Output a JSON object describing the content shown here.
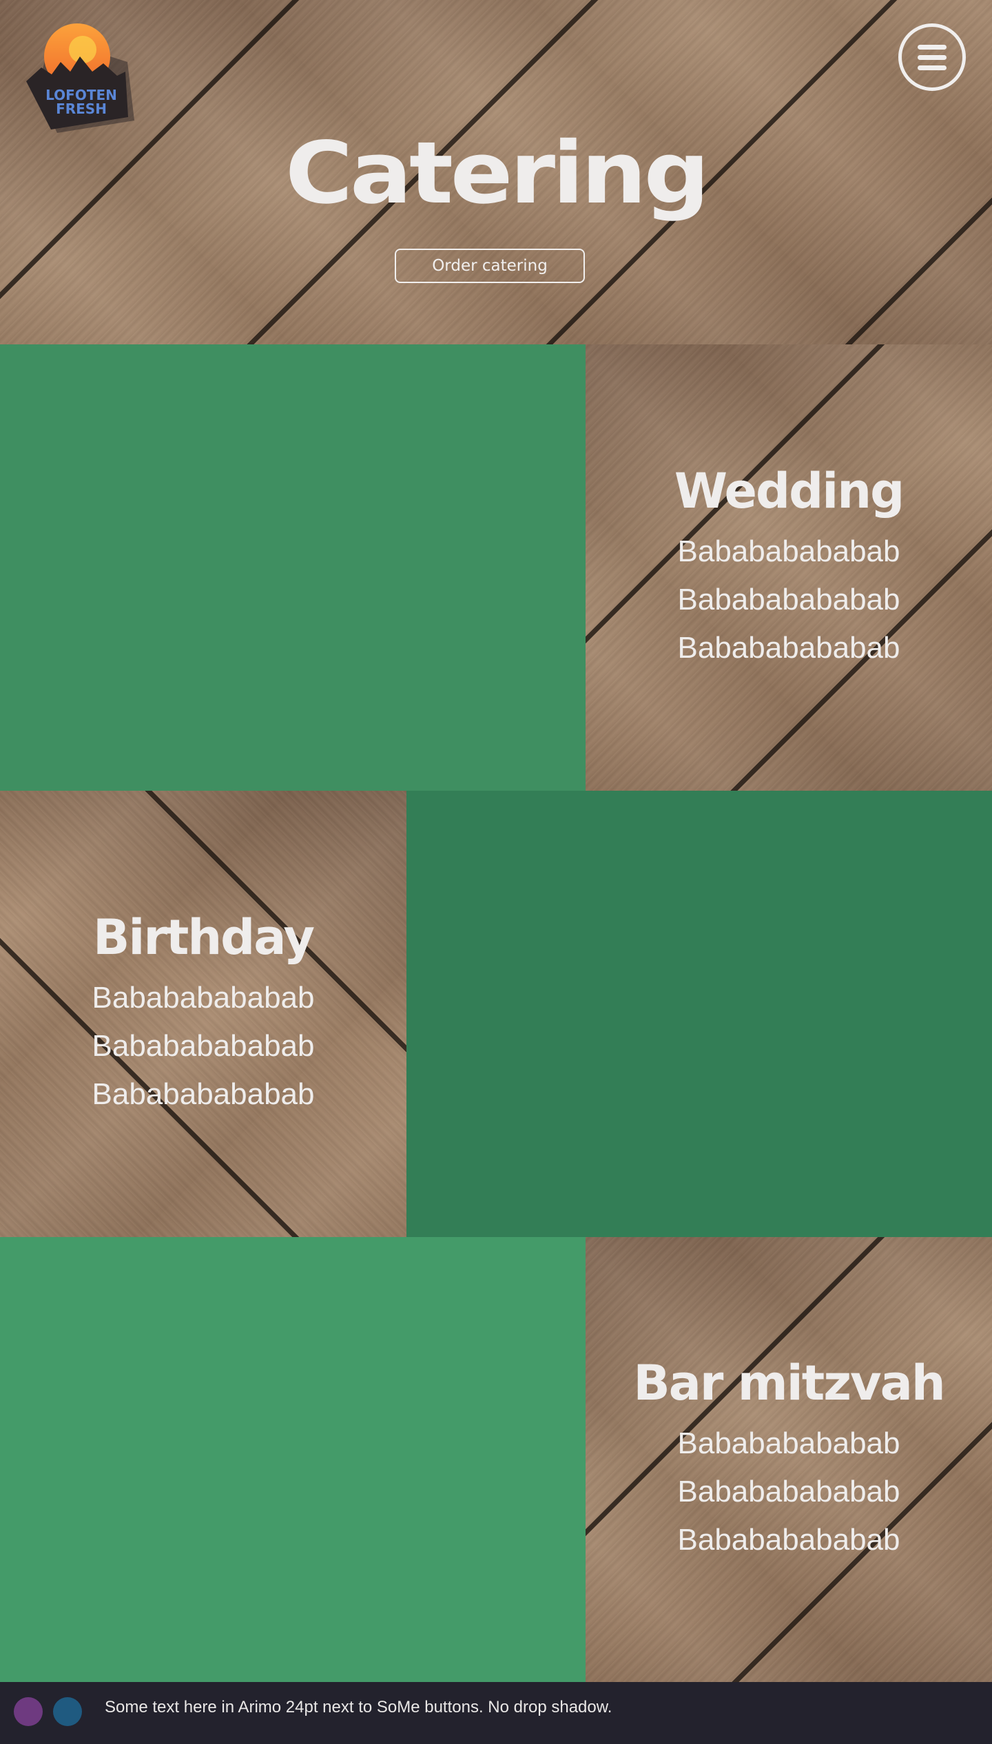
{
  "brand": {
    "line1": "LOFOTEN",
    "line2": "FRESH"
  },
  "hero": {
    "title": "Catering",
    "order_button": "Order catering"
  },
  "events": [
    {
      "title": "Wedding",
      "lines": [
        "Babababababab",
        "Babababababab",
        "Babababababab"
      ]
    },
    {
      "title": "Birthday",
      "lines": [
        "Babababababab",
        "Babababababab",
        "Babababababab"
      ]
    },
    {
      "title": "Bar mitzvah",
      "lines": [
        "Babababababab",
        "Babababababab",
        "Babababababab"
      ]
    }
  ],
  "footer": {
    "text": "Some text here in Arimo 24pt next to SoMe buttons. No drop shadow.",
    "social_colors": [
      "#6e3a80",
      "#1f5a80"
    ]
  },
  "colors": {
    "green_1": "#3f8f61",
    "green_2": "#337e56",
    "green_3": "#449b69",
    "text": "#efedec",
    "footer_bg": "#23222d"
  },
  "icons": {
    "menu": "hamburger-menu-icon"
  }
}
